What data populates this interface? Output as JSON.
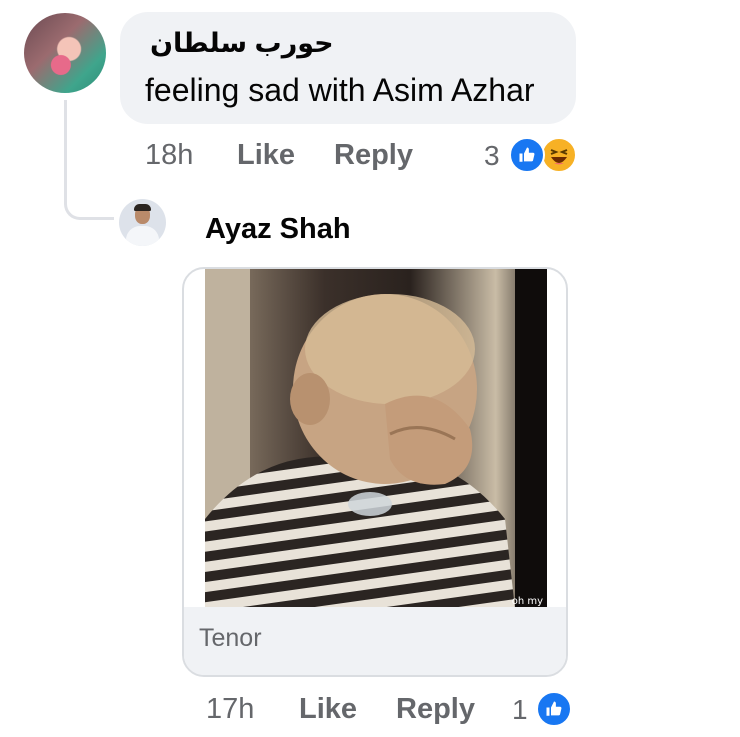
{
  "comment": {
    "author": "حورب سلطان",
    "text": "feeling sad with Asim Azhar",
    "time": "18h",
    "like_label": "Like",
    "reply_label": "Reply",
    "reaction_count": "3",
    "reactions": [
      "like-icon",
      "haha-icon"
    ]
  },
  "reply": {
    "author": "Ayaz Shah",
    "gif": {
      "source": "Tenor",
      "watermark": "oh my"
    },
    "time": "17h",
    "like_label": "Like",
    "reply_label": "Reply",
    "reaction_count": "1",
    "reactions": [
      "like-icon"
    ]
  },
  "colors": {
    "like_blue": "#1877f2",
    "haha_yellow": "#f7b125",
    "bubble_bg": "#f0f2f5",
    "meta_gray": "#65676b"
  }
}
